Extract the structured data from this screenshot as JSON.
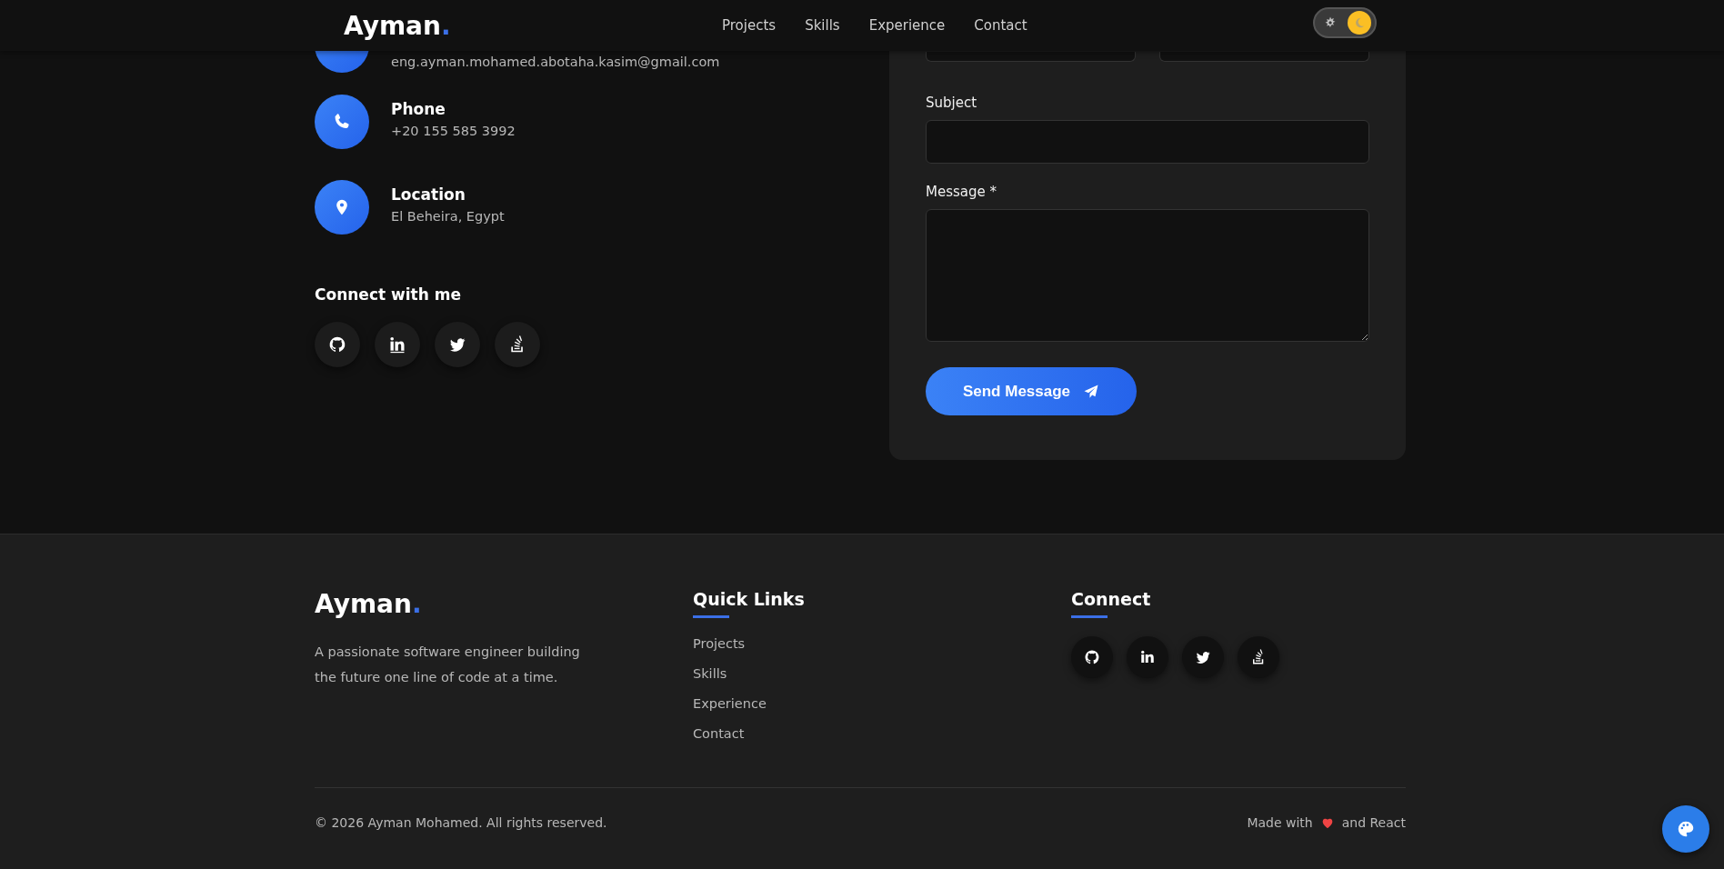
{
  "header": {
    "logo": "Ayman",
    "logo_dot": ".",
    "nav": [
      {
        "label": "Projects"
      },
      {
        "label": "Skills"
      },
      {
        "label": "Experience"
      },
      {
        "label": "Contact"
      }
    ],
    "theme_toggle": {
      "on": true
    }
  },
  "contact_items": [
    {
      "kind": "email",
      "value": "eng.ayman.mohamed.abotaha.kasim@gmail.com"
    },
    {
      "kind": "phone",
      "label": "Phone",
      "value": "+20 155 585 3992"
    },
    {
      "kind": "location",
      "label": "Location",
      "value": "El Beheira, Egypt"
    }
  ],
  "social_heading": "Connect with me",
  "social": [
    {
      "kind": "github"
    },
    {
      "kind": "linkedin"
    },
    {
      "kind": "twitter"
    },
    {
      "kind": "stackoverflow"
    }
  ],
  "form": {
    "fields": [
      {
        "kind": "pair"
      },
      {
        "kind": "input",
        "label": "Subject"
      },
      {
        "kind": "textarea",
        "label": "Message *"
      }
    ],
    "submit": "Send Message"
  },
  "footer": {
    "logo": "Ayman",
    "logo_dot": ".",
    "tagline": "A passionate software engineer building the future one line of code at a time.",
    "quick_links_heading": "Quick Links",
    "quick_links": [
      {
        "label": "Projects"
      },
      {
        "label": "Skills"
      },
      {
        "label": "Experience"
      },
      {
        "label": "Contact"
      }
    ],
    "connect_heading": "Connect",
    "social": [
      {
        "kind": "github"
      },
      {
        "kind": "linkedin"
      },
      {
        "kind": "twitter"
      },
      {
        "kind": "stackoverflow"
      }
    ],
    "copyright": "© 2026 Ayman Mohamed. All rights reserved.",
    "made_with": "Made with",
    "made_with_end": "and React"
  }
}
